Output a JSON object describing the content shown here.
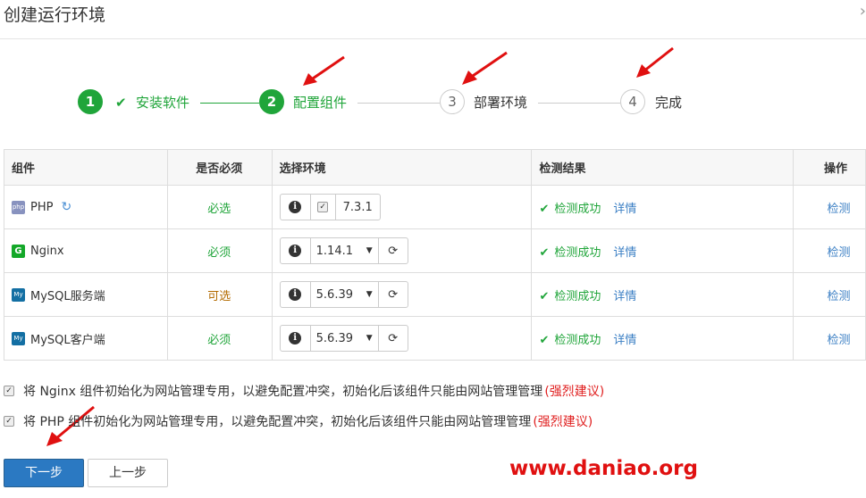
{
  "dialog": {
    "title": "创建运行环境",
    "close_glyph": "›"
  },
  "steps": [
    {
      "num": "1",
      "label": "安装软件",
      "state": "done"
    },
    {
      "num": "2",
      "label": "配置组件",
      "state": "done"
    },
    {
      "num": "3",
      "label": "部署环境",
      "state": "pending"
    },
    {
      "num": "4",
      "label": "完成",
      "state": "pending"
    }
  ],
  "table": {
    "headers": [
      "组件",
      "是否必须",
      "选择环境",
      "检测结果",
      "操作"
    ],
    "rows": [
      {
        "name": "PHP",
        "required": "必选",
        "version": "7.3.1",
        "result": "检测成功",
        "detail": "详情",
        "action": "检测"
      },
      {
        "name": "Nginx",
        "required": "必须",
        "version": "1.14.1",
        "result": "检测成功",
        "detail": "详情",
        "action": "检测"
      },
      {
        "name": "MySQL服务端",
        "required": "可选",
        "version": "5.6.39",
        "result": "检测成功",
        "detail": "详情",
        "action": "检测"
      },
      {
        "name": "MySQL客户端",
        "required": "必须",
        "version": "5.6.39",
        "result": "检测成功",
        "detail": "详情",
        "action": "检测"
      }
    ]
  },
  "options": [
    {
      "text": "将 Nginx 组件初始化为网站管理专用，以避免配置冲突，初始化后该组件只能由网站管理管理",
      "note": "(强烈建议)",
      "checked": true
    },
    {
      "text": "将 PHP 组件初始化为网站管理专用，以避免配置冲突，初始化后该组件只能由网站管理管理",
      "note": "(强烈建议)",
      "checked": true
    }
  ],
  "buttons": {
    "next": "下一步",
    "prev": "上一步"
  },
  "watermark": "www.daniao.org",
  "colors": {
    "green": "#20a53a",
    "blue": "#2b79c2",
    "red": "#e02020"
  }
}
